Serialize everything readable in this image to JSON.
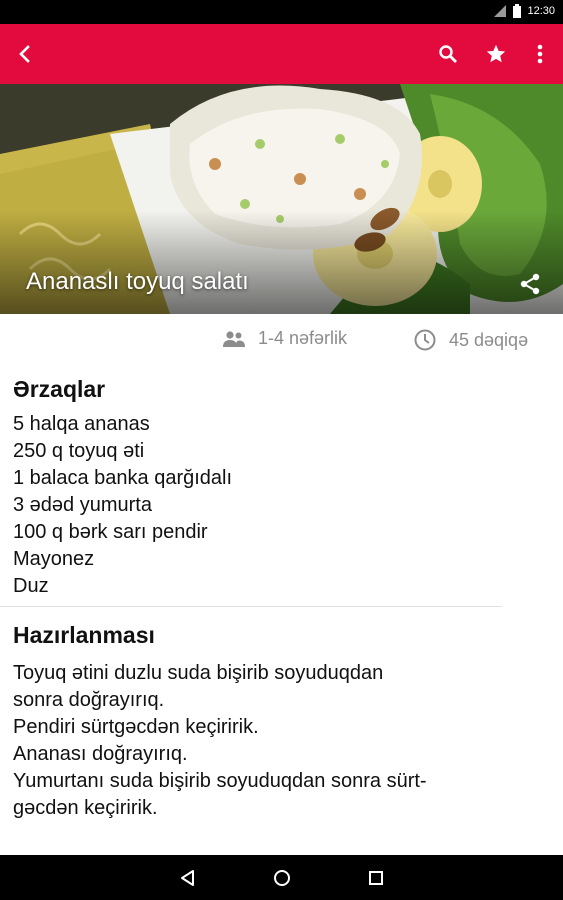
{
  "status_bar": {
    "time": "12:30"
  },
  "toolbar": {
    "accent_color": "#e30b3d",
    "icons": [
      "back-arrow-icon",
      "search-icon",
      "star-icon",
      "more-vert-icon"
    ]
  },
  "hero": {
    "title": "Ananaslı toyuq salatı",
    "share_icon": "share-icon"
  },
  "meta": {
    "servings": "1-4 nəfərlik",
    "time": "45 dəqiqə"
  },
  "ingredients": {
    "title": "Ərzaqlar",
    "items": [
      "5 halqa ananas",
      "250 q toyuq əti",
      "1 balaca banka qarğıdalı",
      "3 ədəd yumurta",
      "100 q bərk sarı pendir",
      "Mayonez",
      "Duz"
    ]
  },
  "preparation": {
    "title": "Hazırlanması",
    "lines": [
      "Toyuq ətini duzlu suda bişirib soyuduqdan",
      "sonra doğrayırıq.",
      "Pendiri sürtgəcdən keçiririk.",
      "Ananası doğrayırıq.",
      "Yumurtanı suda bişirib soyuduqdan sonra sürt-",
      "gəcdən keçiririk."
    ]
  },
  "nav_bar": {
    "icons": [
      "back-icon",
      "home-icon",
      "recents-icon"
    ]
  }
}
